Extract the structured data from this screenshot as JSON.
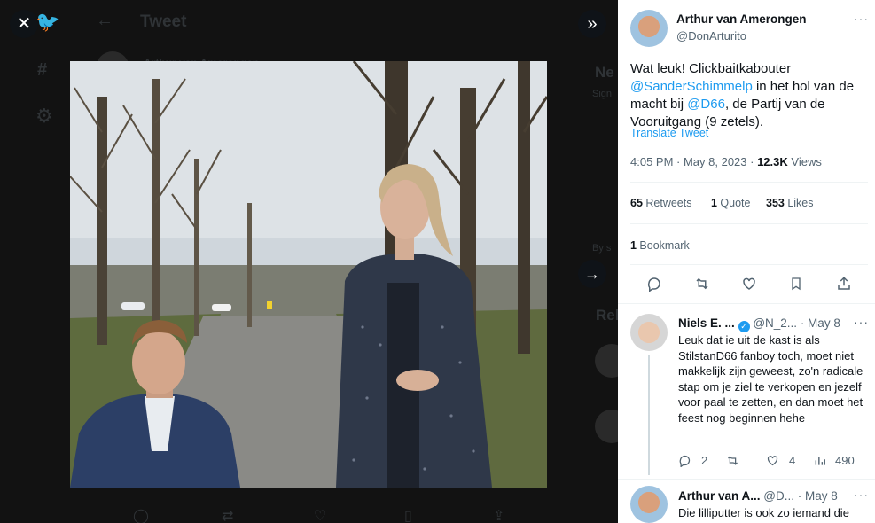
{
  "background_page": {
    "header_title": "Tweet",
    "author_name_partial": "Arthur van Amerongen",
    "sidebar_heading_partial": "Ne",
    "sign_text_partial": "Sign",
    "by_text_partial": "By s",
    "relevant_heading_partial": "Rel"
  },
  "viewer": {
    "close_label": "✕",
    "collapse_label": "»",
    "next_label": "→"
  },
  "tweet": {
    "author_name": "Arthur van Amerongen",
    "author_handle": "@DonArturito",
    "text_part1": "Wat leuk! Clickbaitkabouter ",
    "mention1": "@SanderSchimmelp",
    "text_part2": " in het hol van de macht bij ",
    "mention2": "@D66",
    "text_part3": ", de Partij van de Vooruitgang (9 zetels).",
    "translate_label": "Translate Tweet",
    "time": "4:05 PM · May 8, 2023 · ",
    "views_count": "12.3K",
    "views_label": " Views",
    "retweets_count": "65",
    "retweets_label": " Retweets",
    "quotes_count": "1",
    "quotes_label": " Quote",
    "likes_count": "353",
    "likes_label": " Likes",
    "bookmarks_count": "1",
    "bookmarks_label": " Bookmark"
  },
  "replies": [
    {
      "name": "Niels E. ...",
      "handle": "@N_2...",
      "date": "· May 8",
      "text": "Leuk dat ie uit de kast is als StilstanD66 fanboy toch, moet niet makkelijk zijn geweest, zo'n radicale stap om je ziel te verkopen en jezelf voor paal te zetten, en dan moet het feest nog beginnen hehe",
      "replies": "2",
      "likes": "4",
      "views": "490"
    },
    {
      "name": "Arthur van A...",
      "handle": "@D...",
      "date": "· May 8",
      "text": "Die lilliputter is ook zo iemand die"
    }
  ],
  "icons": {
    "close": "close-icon",
    "collapse": "chevron-double-right-icon",
    "next": "arrow-right-icon",
    "reply": "reply-icon",
    "retweet": "retweet-icon",
    "like": "heart-icon",
    "bookmark": "bookmark-icon",
    "share": "share-icon",
    "views": "views-chart-icon",
    "more": "more-icon",
    "verified": "verified-icon"
  },
  "colors": {
    "link": "#1d9bf0",
    "secondary_text": "#536471",
    "primary_text": "#0f1419",
    "viewer_bg": "#121212"
  }
}
